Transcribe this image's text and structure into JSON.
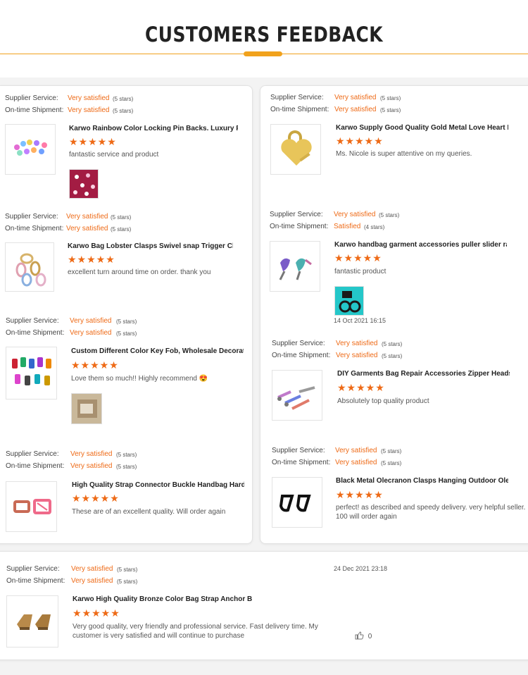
{
  "heading": "CUSTOMERS FEEDBACK",
  "labels": {
    "supplier": "Supplier Service:",
    "shipment": "On-time Shipment:"
  },
  "colors": {
    "accent": "#f1a21c",
    "rating": "#ee6a16"
  },
  "star_glyphs": "★★★★★",
  "reviews": [
    {
      "supplier_value": "Very satisfied",
      "supplier_stars": "(5 stars)",
      "shipment_value": "Very satisfied",
      "shipment_stars": "(5 stars)",
      "product": "Karwo Rainbow Color Locking Pin Backs. Luxury Pin ...",
      "rating": 5,
      "comment": "fantastic service and product",
      "thumb_icon": "pin-backs-image",
      "photo_icon": "pins-photo"
    },
    {
      "supplier_value": "Very satisfied",
      "supplier_stars": "(5 stars)",
      "shipment_value": "Very satisfied",
      "shipment_stars": "(5 stars)",
      "product": "Karwo Supply Good Quality Gold Metal Love Heart Lo...",
      "rating": 5,
      "comment": "Ms. Nicole is super attentive on my queries.",
      "thumb_icon": "heart-lock-image"
    },
    {
      "supplier_value": "Very satisfied",
      "supplier_stars": "(5 stars)",
      "shipment_value": "Very satisfied",
      "shipment_stars": "(5 stars)",
      "product": "Karwo Bag Lobster Clasps Swivel snap Trigger Clips ...",
      "rating": 5,
      "comment": "excellent turn around time on order. thank you",
      "thumb_icon": "lobster-clasps-image"
    },
    {
      "supplier_value": "Very satisfied",
      "supplier_stars": "(5 stars)",
      "shipment_value": "Satisfied",
      "shipment_stars": "(4 stars)",
      "product": "Karwo handbag garment accessories puller slider rain...",
      "rating": 5,
      "comment": "fantastic product",
      "date": "14 Oct 2021 16:15",
      "thumb_icon": "slider-pullers-image",
      "photo_icon": "rings-photo"
    },
    {
      "supplier_value": "Very satisfied",
      "supplier_stars": "(5 stars)",
      "shipment_value": "Very satisfied",
      "shipment_stars": "(5 stars)",
      "product": "Custom Different Color Key Fob, Wholesale Decorativ...",
      "rating": 5,
      "comment": "Love them so much!! Highly recommend 😍",
      "thumb_icon": "key-fob-image",
      "photo_icon": "package-photo"
    },
    {
      "supplier_value": "Very satisfied",
      "supplier_stars": "(5 stars)",
      "shipment_value": "Very satisfied",
      "shipment_stars": "(5 stars)",
      "product": "DIY Garments Bag Repair Accessories Zipper Heads ...",
      "rating": 5,
      "comment": "Absolutely top quality product",
      "thumb_icon": "zipper-heads-image"
    },
    {
      "supplier_value": "Very satisfied",
      "supplier_stars": "(5 stars)",
      "shipment_value": "Very satisfied",
      "shipment_stars": "(5 stars)",
      "product": "High Quality Strap Connector Buckle Handbag Hardw...",
      "rating": 5,
      "comment": "These are of an excellent quality.  Will order again",
      "thumb_icon": "strap-buckle-image"
    },
    {
      "supplier_value": "Very satisfied",
      "supplier_stars": "(5 stars)",
      "shipment_value": "Very satisfied",
      "shipment_stars": "(5 stars)",
      "product": "Black Metal Olecranon Clasps Hanging Outdoor Olecr...",
      "rating": 5,
      "comment": "perfect! as described and speedy delivery. very helpful seller. 100 will order again",
      "thumb_icon": "olecranon-clasps-image"
    },
    {
      "supplier_value": "Very satisfied",
      "supplier_stars": "(5 stars)",
      "shipment_value": "Very satisfied",
      "shipment_stars": "(5 stars)",
      "product": "Karwo High Quality Bronze Color Bag Strap Anchor Bu...",
      "rating": 5,
      "comment": "Very good quality, very friendly and professional service. Fast delivery time. My customer is very satisfied and will continue to purchase",
      "date": "24 Dec 2021 23:18",
      "likes": "0",
      "thumb_icon": "anchor-buckle-image"
    }
  ]
}
